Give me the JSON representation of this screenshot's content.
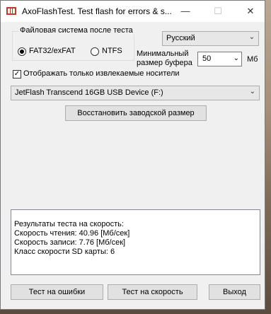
{
  "window": {
    "title": "AxoFlashTest. Test flash for errors & s...",
    "minimize_glyph": "—",
    "maximize_glyph": "☐",
    "close_glyph": "✕"
  },
  "fs_group": {
    "title": "Файловая система после теста",
    "options": [
      "FAT32/exFAT",
      "NTFS"
    ],
    "selected": "FAT32/exFAT"
  },
  "language": {
    "value": "Русский"
  },
  "buffer": {
    "label_line1": "Минимальный",
    "label_line2": "размер буфера",
    "value": "50",
    "unit": "Мб"
  },
  "removable_only": {
    "label": "Отображать только извлекаемые носители",
    "checked": true
  },
  "device": {
    "value": "JetFlash Transcend 16GB USB Device (F:)"
  },
  "restore_button": "Восстановить заводской размер",
  "results": {
    "lines": [
      "Результаты теста на скорость:",
      "Скорость чтения: 40.96 [Мб/сек]",
      "Скорость записи: 7.76 [Мб/сек]",
      "Класс скорости SD карты: 6"
    ]
  },
  "buttons": {
    "test_errors": "Тест на ошибки",
    "test_speed": "Тест на скорость",
    "exit": "Выход"
  },
  "colors": {
    "window_bg": "#f0f0f0",
    "button_bg": "#e1e1e1",
    "border": "#adadad"
  }
}
